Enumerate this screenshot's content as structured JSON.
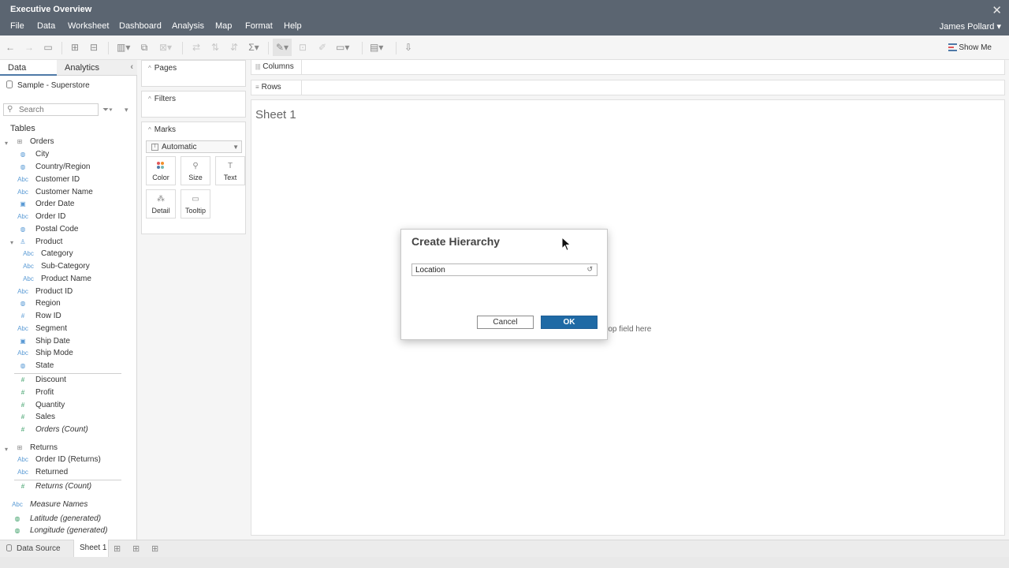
{
  "app": {
    "title": "Executive Overview",
    "close_glyph": "✕",
    "user": "James Pollard ▾"
  },
  "menu": [
    "File",
    "Data",
    "Worksheet",
    "Dashboard",
    "Analysis",
    "Map",
    "Format",
    "Help"
  ],
  "toolbar": {
    "show_me_label": "Show Me",
    "icons": [
      "undo-icon",
      "redo-icon",
      "save-icon",
      "new-data-source-icon",
      "pause-updates-icon",
      "new-worksheet-icon",
      "duplicate-icon",
      "clear-icon",
      "swap-icon",
      "sort-ascending-icon",
      "sort-descending-icon",
      "totals-icon",
      "highlight-icon",
      "group-icon",
      "labels-icon",
      "fix-axes-icon",
      "fit-icon",
      "presentation-icon",
      "share-icon"
    ]
  },
  "data_pane": {
    "tab_data": "Data",
    "tab_analytics": "Analytics",
    "collapse_glyph": "‹",
    "data_source": "Sample - Superstore",
    "search_placeholder": "Search",
    "tables_label": "Tables",
    "tables": [
      {
        "name": "Orders",
        "fields": [
          {
            "name": "City",
            "type": "geo"
          },
          {
            "name": "Country/Region",
            "type": "geo"
          },
          {
            "name": "Customer ID",
            "type": "abc"
          },
          {
            "name": "Customer Name",
            "type": "abc"
          },
          {
            "name": "Order Date",
            "type": "date"
          },
          {
            "name": "Order ID",
            "type": "abc"
          },
          {
            "name": "Postal Code",
            "type": "geo"
          },
          {
            "name": "Product",
            "type": "hierarchy",
            "children": [
              "Category",
              "Sub-Category",
              "Product Name"
            ]
          },
          {
            "name": "Product ID",
            "type": "abc"
          },
          {
            "name": "Region",
            "type": "geo"
          },
          {
            "name": "Row ID",
            "type": "num"
          },
          {
            "name": "Segment",
            "type": "abc"
          },
          {
            "name": "Ship Date",
            "type": "date"
          },
          {
            "name": "Ship Mode",
            "type": "abc"
          },
          {
            "name": "State",
            "type": "geo"
          }
        ],
        "measures": [
          "Discount",
          "Profit",
          "Quantity",
          "Sales",
          "Orders (Count)"
        ]
      },
      {
        "name": "Returns",
        "fields": [
          {
            "name": "Order ID (Returns)",
            "type": "abc"
          },
          {
            "name": "Returned",
            "type": "abc"
          }
        ],
        "measures": [
          "Returns (Count)"
        ]
      }
    ],
    "extra_fields": [
      "Measure Names",
      "Latitude (generated)",
      "Longitude (generated)"
    ]
  },
  "cards": {
    "pages": "Pages",
    "filters": "Filters",
    "marks": "Marks",
    "mark_type": "Automatic",
    "mark_buttons": [
      "Color",
      "Size",
      "Text",
      "Detail",
      "Tooltip"
    ]
  },
  "shelves": {
    "columns": "Columns",
    "rows": "Rows"
  },
  "canvas": {
    "sheet_title": "Sheet 1",
    "drop_hint": "rop field here"
  },
  "bottom": {
    "data_source": "Data Source",
    "sheet_tab": "Sheet 1"
  },
  "dialog": {
    "title": "Create Hierarchy",
    "input_value": "Location",
    "clear_glyph": "↺",
    "cancel": "Cancel",
    "ok": "OK"
  },
  "colors": {
    "titlebar": "#5b6571",
    "ok_button": "#1f6aa5",
    "dimension_icon": "#5b9bd5",
    "measure_icon": "#3fa06a"
  }
}
